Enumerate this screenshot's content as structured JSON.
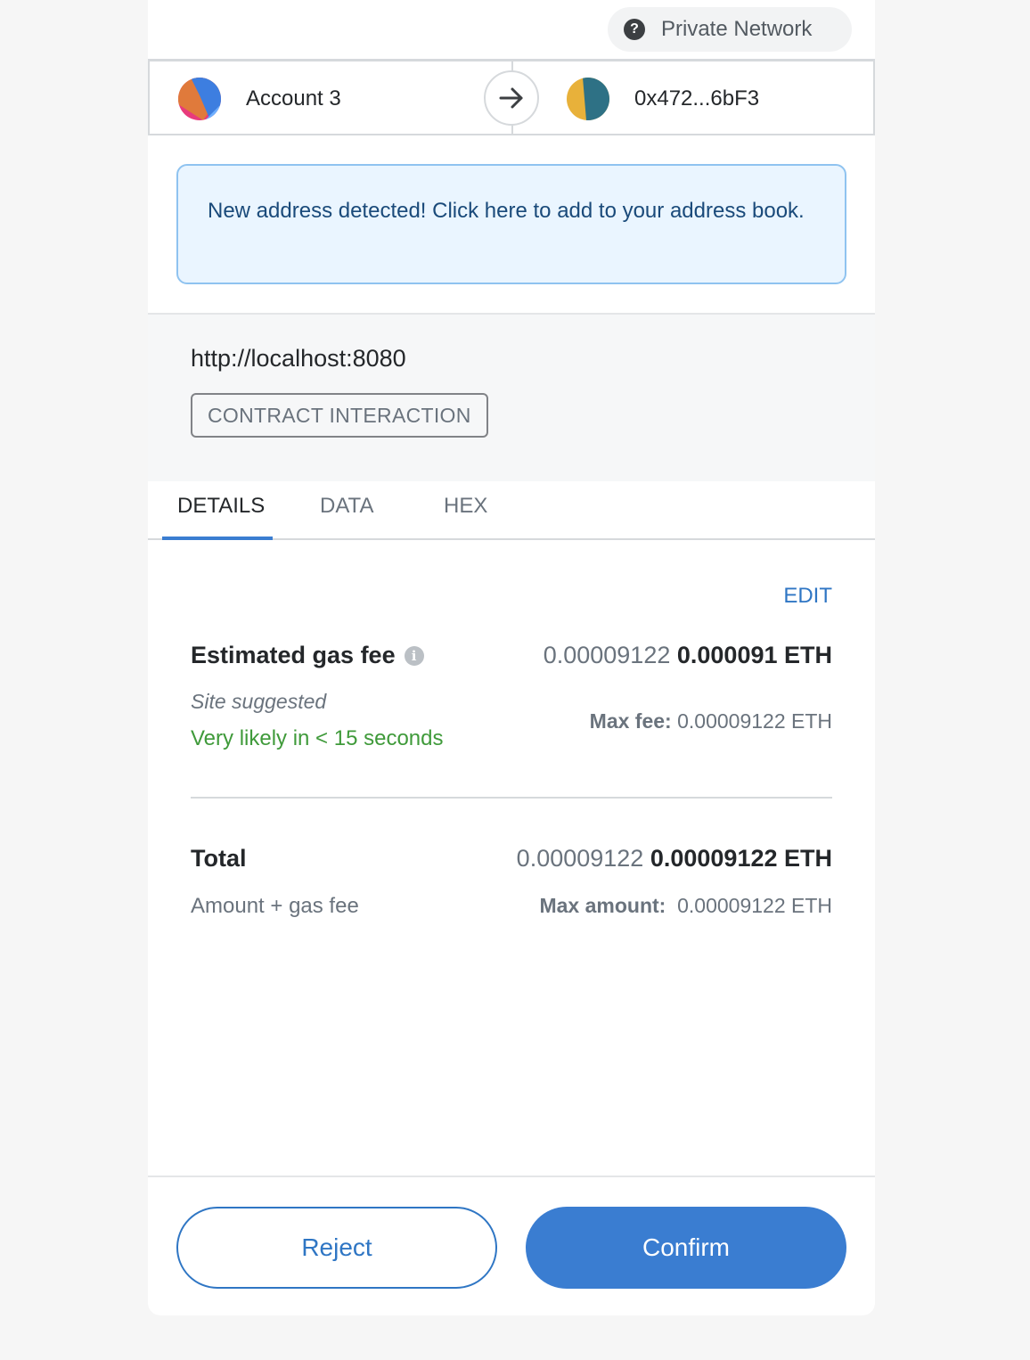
{
  "header": {
    "network_label": "Private Network",
    "help_icon": "?"
  },
  "transfer": {
    "sender_name": "Account 3",
    "recipient_address": "0x472...6bF3",
    "arrow_icon": "arrow-right-icon"
  },
  "notice": {
    "text": "New address detected! Click here to add to your address book."
  },
  "origin": {
    "url": "http://localhost:8080",
    "transaction_type": "CONTRACT INTERACTION"
  },
  "tabs": [
    {
      "label": "DETAILS",
      "active": true
    },
    {
      "label": "DATA",
      "active": false
    },
    {
      "label": "HEX",
      "active": false
    }
  ],
  "details": {
    "edit_label": "EDIT",
    "gas": {
      "label": "Estimated gas fee",
      "info_icon": "i",
      "value_secondary": "0.00009122",
      "value_primary": "0.000091 ETH",
      "source": "Site suggested",
      "likelihood": "Very likely in < 15 seconds",
      "max_fee_label": "Max fee:",
      "max_fee_value": "0.00009122 ETH"
    },
    "total": {
      "label": "Total",
      "value_secondary": "0.00009122",
      "value_primary": "0.00009122 ETH",
      "sub_label": "Amount + gas fee",
      "max_amount_label": "Max amount:",
      "max_amount_value": "0.00009122 ETH"
    }
  },
  "footer": {
    "reject_label": "Reject",
    "confirm_label": "Confirm"
  },
  "colors": {
    "accent": "#3a7dd1",
    "success": "#3f9a3a",
    "notice_bg": "#eaf5ff",
    "notice_border": "#8fc3f0"
  }
}
